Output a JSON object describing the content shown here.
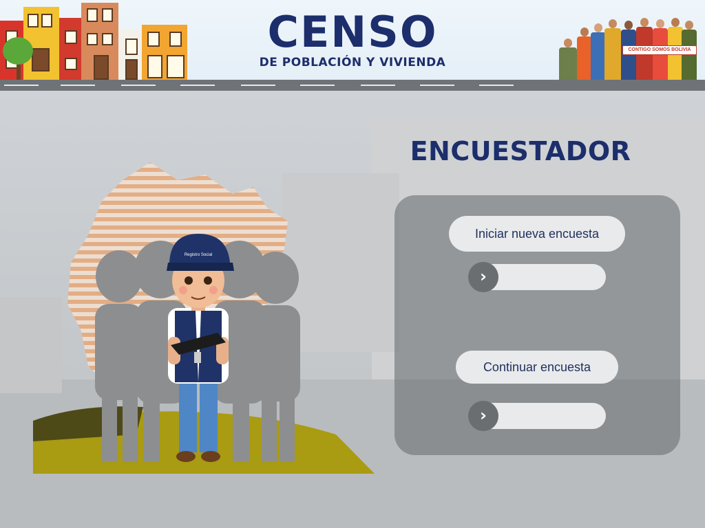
{
  "header": {
    "title": "CENSO",
    "subtitle": "DE POBLACIÓN Y VIVIENDA",
    "banner_text": "CONTIGO SOMOS BOLIVIA"
  },
  "illustration": {
    "cap_text": "Registro Social"
  },
  "panel": {
    "title": "ENCUESTADOR",
    "new_survey_label": "Iniciar nueva encuesta",
    "continue_survey_label": "Continuar encuesta",
    "slider_icon": "chevron-right-icon",
    "slider_glyph": "›"
  },
  "colors": {
    "title_navy": "#1c2e6b",
    "panel_gray": "#6e7276",
    "pill_bg": "#e9eaec",
    "knob_gray": "#6b6e71"
  }
}
